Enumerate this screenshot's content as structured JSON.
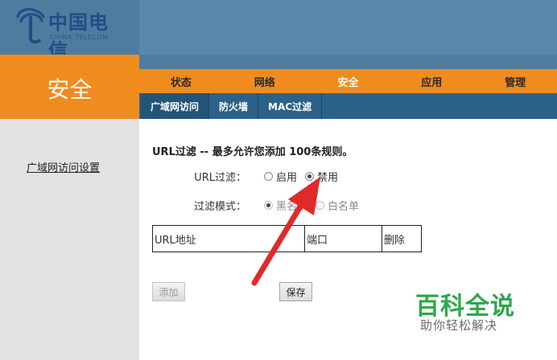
{
  "brand": {
    "name": "中国电信",
    "subtitle": "CHINA TELECOM",
    "logo_color": "#1d4f86"
  },
  "section": {
    "title": "安全"
  },
  "sidebar": {
    "items": [
      {
        "label": "广域网访问设置"
      }
    ]
  },
  "main_nav": {
    "items": [
      {
        "label": "状态"
      },
      {
        "label": "网络"
      },
      {
        "label": "安全"
      },
      {
        "label": "应用"
      },
      {
        "label": "管理"
      }
    ],
    "active": "安全"
  },
  "sub_nav": {
    "items": [
      {
        "label": "广域网访问"
      },
      {
        "label": "防火墙"
      },
      {
        "label": "MAC过滤"
      }
    ],
    "active": "广域网访问"
  },
  "content": {
    "heading": "URL过滤 -- 最多允许您添加 100条规则。",
    "url_filter": {
      "label": "URL过滤：",
      "options": [
        {
          "label": "启用",
          "checked": false
        },
        {
          "label": "禁用",
          "checked": true
        }
      ]
    },
    "filter_mode": {
      "label": "过滤模式：",
      "options": [
        {
          "label": "黑名单",
          "checked": true
        },
        {
          "label": "白名单",
          "checked": false
        }
      ],
      "disabled": true
    },
    "table": {
      "columns": [
        {
          "label": "URL地址"
        },
        {
          "label": "端口"
        },
        {
          "label": "删除"
        }
      ]
    },
    "buttons": {
      "add": "添加",
      "save": "保存"
    }
  },
  "watermark": {
    "main": "百科全说",
    "sub": "助你轻松解决"
  },
  "colors": {
    "header_blue": "#4f7b9f",
    "accent_orange": "#f08c1e",
    "subnav_blue": "#2c6289",
    "sidebar_gray": "#e2e2e2",
    "arrow_red": "#e02a2a",
    "watermark_green": "#2ea84b"
  }
}
